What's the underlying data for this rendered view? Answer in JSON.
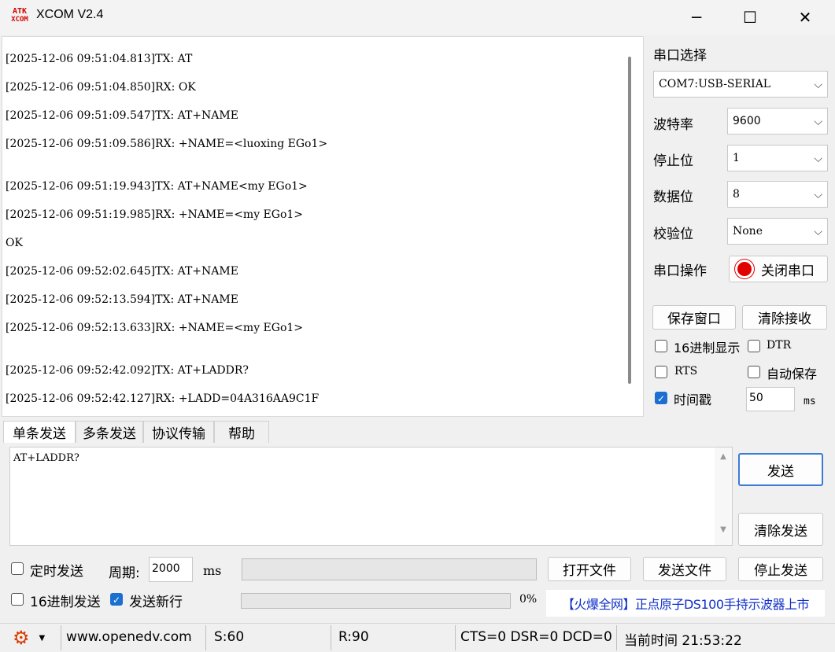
{
  "window": {
    "title": "XCOM V2.4",
    "logo_top": "ATK",
    "logo_bottom": "XCOM",
    "minimize": "─",
    "maximize": "☐",
    "close": "✕"
  },
  "log_lines": [
    "[2025-12-06 09:51:04.813]TX: AT",
    "[2025-12-06 09:51:04.850]RX: OK",
    "[2025-12-06 09:51:09.547]TX: AT+NAME",
    "[2025-12-06 09:51:09.586]RX: +NAME=<luoxing EGo1>",
    "[2025-12-06 09:51:19.943]TX: AT+NAME<my EGo1>",
    "[2025-12-06 09:51:19.985]RX: +NAME=<my EGo1>",
    "OK",
    "[2025-12-06 09:52:02.645]TX: AT+NAME",
    "[2025-12-06 09:52:13.594]TX: AT+NAME",
    "[2025-12-06 09:52:13.633]RX: +NAME=<my EGo1>",
    "[2025-12-06 09:52:42.092]TX: AT+LADDR?",
    "[2025-12-06 09:52:42.127]RX: +LADD=04A316AA9C1F"
  ],
  "settings": {
    "port_label": "串口选择",
    "port_value": "COM7:USB-SERIAL",
    "baud_label": "波特率",
    "baud_value": "9600",
    "stop_label": "停止位",
    "stop_value": "1",
    "data_label": "数据位",
    "data_value": "8",
    "parity_label": "校验位",
    "parity_value": "None",
    "op_label": "串口操作",
    "op_button": "关闭串口",
    "save_window": "保存窗口",
    "clear_recv": "清除接收",
    "hex_display": "16进制显示",
    "dtr": "DTR",
    "rts": "RTS",
    "auto_save": "自动保存",
    "timestamp": "时间戳",
    "timestamp_value": "50",
    "timestamp_unit": "ms"
  },
  "tabs": [
    "单条发送",
    "多条发送",
    "协议传输",
    "帮助"
  ],
  "send": {
    "text": "AT+LADDR?",
    "send_button": "发送",
    "clear_send": "清除发送",
    "timed_send": "定时发送",
    "period_label": "周期:",
    "period_value": "2000",
    "period_unit": "ms",
    "open_file": "打开文件",
    "send_file": "发送文件",
    "stop_send": "停止发送",
    "hex_send": "16进制发送",
    "newline": "发送新行",
    "progress_text": "0%",
    "progress": 0,
    "ad_text": "【火爆全网】正点原子DS100手持示波器上市"
  },
  "status": {
    "website": "www.openedv.com",
    "sent": "S:60",
    "received": "R:90",
    "signals": "CTS=0 DSR=0 DCD=0",
    "time": "当前时间 21:53:22"
  },
  "colors": {
    "accent": "#1a6fd1",
    "logo": "#d40000",
    "ad": "#1030c8",
    "gear": "#d83b01"
  }
}
